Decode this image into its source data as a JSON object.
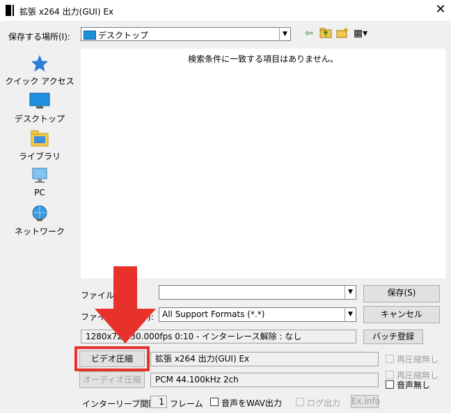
{
  "window": {
    "title": "拡張 x264 出力(GUI) Ex",
    "close": "✕"
  },
  "location": {
    "label": "保存する場所(I):",
    "value": "デスクトップ"
  },
  "toolbar": {
    "back": "⇦",
    "up": "📁",
    "newfolder": "✱",
    "view": "▦▾"
  },
  "sidebar": [
    {
      "label": "クイック アクセス",
      "icon": "star-icon"
    },
    {
      "label": "デスクトップ",
      "icon": "desktop-icon"
    },
    {
      "label": "ライブラリ",
      "icon": "library-icon"
    },
    {
      "label": "PC",
      "icon": "pc-icon"
    },
    {
      "label": "ネットワーク",
      "icon": "network-icon"
    }
  ],
  "filelist": {
    "empty_message": "検索条件に一致する項目はありません。"
  },
  "filename": {
    "label": "ファイル名(N):",
    "value": ""
  },
  "filetype": {
    "label": "ファイルの種類(T):",
    "value": "All Support Formats (*.*)"
  },
  "buttons": {
    "save": "保存(S)",
    "cancel": "キャンセル",
    "batch": "バッチ登録",
    "video": "ビデオ圧縮",
    "audio": "オーディオ圧縮",
    "ex_info": "Ex.info"
  },
  "info": {
    "video_info": "1280x720  30.000fps  0:10  -  インターレース解除 : なし",
    "video_codec": "拡張 x264 出力(GUI) Ex",
    "audio_codec": "PCM 44.100kHz 2ch"
  },
  "checks": {
    "no_recompress_video": "再圧縮無し",
    "no_recompress_audio": "再圧縮無し",
    "no_audio": "音声無し",
    "wav_output": "音声をWAV出力",
    "log_output": "ログ出力"
  },
  "interleave": {
    "label": "インターリーブ間隔 :",
    "value": "1",
    "unit": "フレーム"
  },
  "colors": {
    "accent": "#0078d7",
    "annotation_red": "#e8312a"
  }
}
